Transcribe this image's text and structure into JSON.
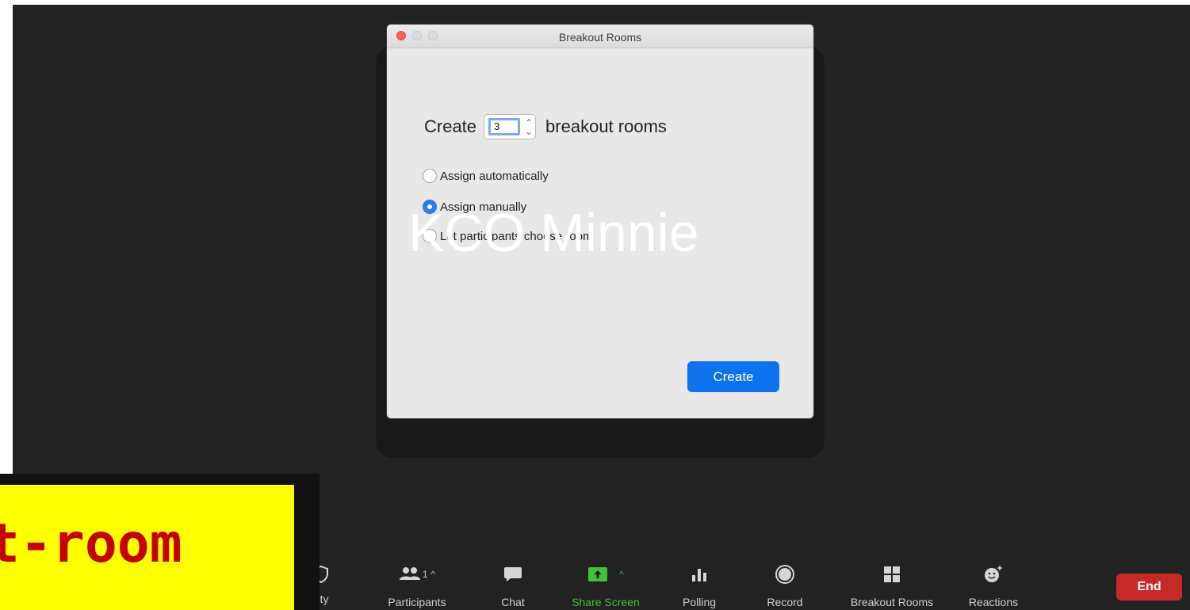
{
  "watermark": "KCO Minnie",
  "dialog": {
    "title": "Breakout Rooms",
    "create_prefix": "Create",
    "room_count": "3",
    "create_suffix": "breakout rooms",
    "options": [
      {
        "label": "Assign automatically",
        "checked": false
      },
      {
        "label": "Assign manually",
        "checked": true
      },
      {
        "label": "Let participants choose room",
        "checked": false
      }
    ],
    "create_button": "Create"
  },
  "toolbar": {
    "security_label": "urity",
    "participants_label": "Participants",
    "participants_count": "1",
    "chat_label": "Chat",
    "share_label": "Share Screen",
    "polling_label": "Polling",
    "record_label": "Record",
    "breakout_label": "Breakout Rooms",
    "reactions_label": "Reactions",
    "end_label": "End"
  },
  "banner_text": "t-room",
  "colors": {
    "accent": "#0e72ed",
    "end": "#c62a28",
    "share_green": "#41c03d",
    "banner_bg": "#ffff00",
    "banner_text": "#c40000"
  },
  "icons": [
    "shield-icon",
    "participants-icon",
    "chat-icon",
    "share-screen-icon",
    "polling-icon",
    "record-icon",
    "breakout-rooms-icon",
    "reactions-icon"
  ]
}
